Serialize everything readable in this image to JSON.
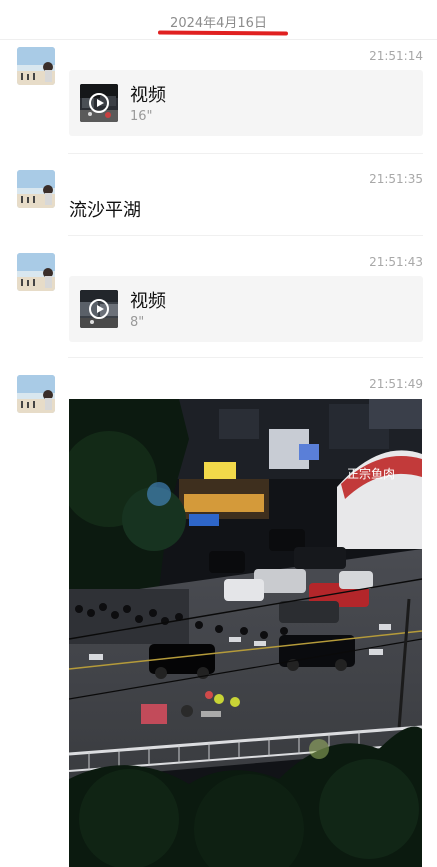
{
  "date_header": {
    "label": "2024年4月16日",
    "underline_color": "#e02020"
  },
  "messages": [
    {
      "type": "video",
      "time": "21:51:14",
      "label": "视频",
      "duration": "16\""
    },
    {
      "type": "text",
      "time": "21:51:35",
      "text": "流沙平湖"
    },
    {
      "type": "video",
      "time": "21:51:43",
      "label": "视频",
      "duration": "8\""
    },
    {
      "type": "image",
      "time": "21:51:49",
      "photo": {
        "shop_sign": "正宗鱼肉"
      }
    }
  ],
  "icons": {
    "avatar": "avatar-beach-photo",
    "play": "play-circle-icon"
  }
}
